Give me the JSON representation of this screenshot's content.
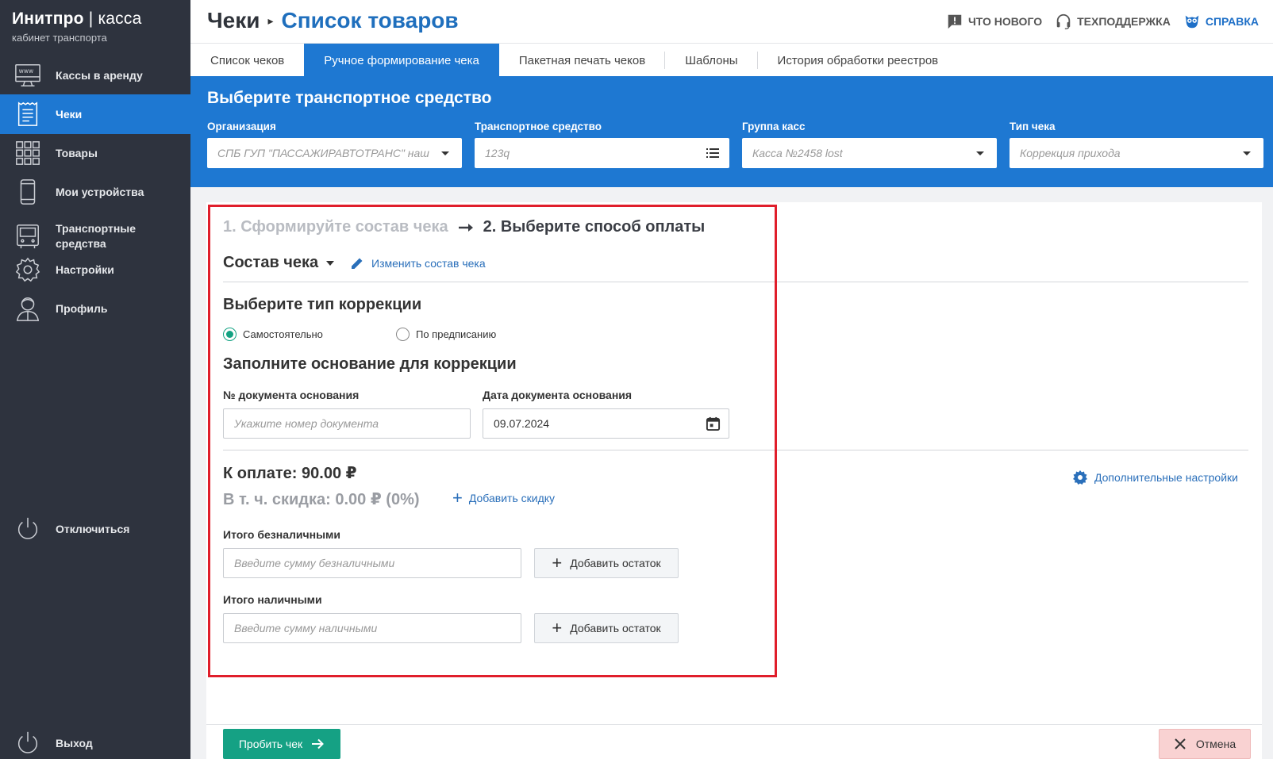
{
  "brand": {
    "title_bold": "Инитпро",
    "title_sep": " | ",
    "title_light": "касса",
    "subtitle": "кабинет транспорта"
  },
  "sidebar": {
    "items": [
      {
        "label": "Кассы в аренду",
        "icon": "www-monitor-icon"
      },
      {
        "label": "Чеки",
        "icon": "receipt-icon",
        "active": true
      },
      {
        "label": "Товары",
        "icon": "grid-icon"
      },
      {
        "label": "Мои устройства",
        "icon": "phone-icon"
      },
      {
        "label": "Транспортные средства",
        "icon": "bus-icon"
      },
      {
        "label": "Настройки",
        "icon": "gear-icon"
      },
      {
        "label": "Профиль",
        "icon": "user-icon"
      }
    ],
    "disconnect": "Отключиться",
    "logout": "Выход"
  },
  "header": {
    "crumb_root": "Чеки",
    "crumb_current": "Список товаров",
    "links": {
      "news": "ЧТО НОВОГО",
      "support": "ТЕХПОДДЕРЖКА",
      "help": "СПРАВКА"
    }
  },
  "tabs": [
    {
      "label": "Список чеков"
    },
    {
      "label": "Ручное формирование чека",
      "active": true
    },
    {
      "label": "Пакетная печать чеков"
    },
    {
      "label": "Шаблоны"
    },
    {
      "label": "История обработки реестров"
    }
  ],
  "vehicle": {
    "title": "Выберите транспортное средство",
    "fields": [
      {
        "label": "Организация",
        "value": "СПБ ГУП \"ПАССАЖИРАВТОТРАНС\" наш"
      },
      {
        "label": "Транспортное средство",
        "value": "123q"
      },
      {
        "label": "Группа касс",
        "value": "Касса №2458 lost"
      },
      {
        "label": "Тип чека",
        "value": "Коррекция прихода"
      }
    ]
  },
  "steps": {
    "step1": "1. Сформируйте состав чека",
    "step2": "2. Выберите способ оплаты"
  },
  "composition": {
    "label": "Состав чека",
    "edit": "Изменить состав чека"
  },
  "correction": {
    "type_title": "Выберите тип коррекции",
    "option_self": "Самостоятельно",
    "option_order": "По предписанию",
    "basis_title": "Заполните основание для коррекции",
    "doc_number_label": "№ документа основания",
    "doc_number_placeholder": "Укажите номер документа",
    "doc_date_label": "Дата документа основания",
    "doc_date_value": "09.07.2024"
  },
  "payment": {
    "total": "К оплате: 90.00 ₽",
    "discount": "В т. ч. скидка: 0.00 ₽ (0%)",
    "add_discount": "Добавить скидку",
    "advanced": "Дополнительные настройки",
    "cashless_label": "Итого безналичными",
    "cashless_placeholder": "Введите сумму безналичными",
    "cash_label": "Итого наличными",
    "cash_placeholder": "Введите сумму наличными",
    "add_remainder": "Добавить остаток"
  },
  "footer": {
    "submit": "Пробить чек",
    "cancel": "Отмена"
  },
  "colors": {
    "sidebar": "#2e333e",
    "primary": "#1e78d2",
    "success": "#15a184",
    "highlight": "#e01e2b"
  }
}
